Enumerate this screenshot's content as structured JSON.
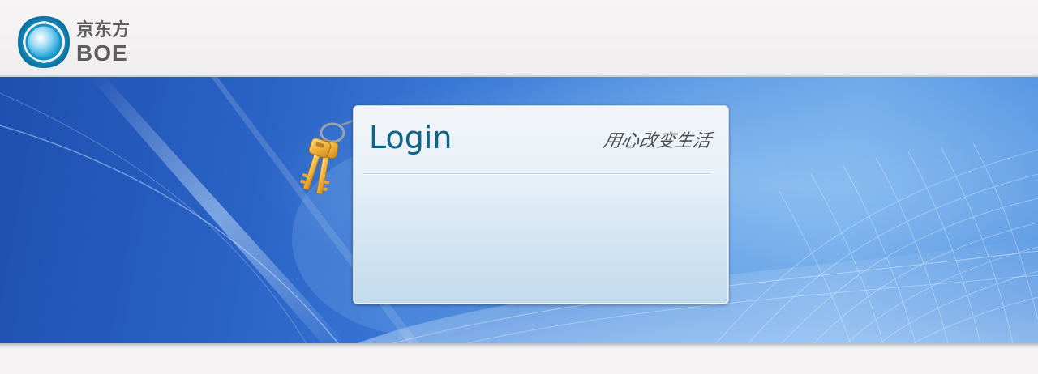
{
  "brand": {
    "name_cn": "京东方",
    "name_en": "BOE",
    "logo_icon": "boe-logo-icon",
    "colors": {
      "logo_blue": "#1a9fd2",
      "logo_text": "#5d5d5d"
    }
  },
  "banner": {
    "colors": {
      "dark_blue": "#1f4fb0",
      "light_blue": "#6aa6ea"
    }
  },
  "login": {
    "title": "Login",
    "slogan": "用心改变生活",
    "keys_icon": "keys-icon",
    "colors": {
      "title": "#0f6588"
    }
  }
}
